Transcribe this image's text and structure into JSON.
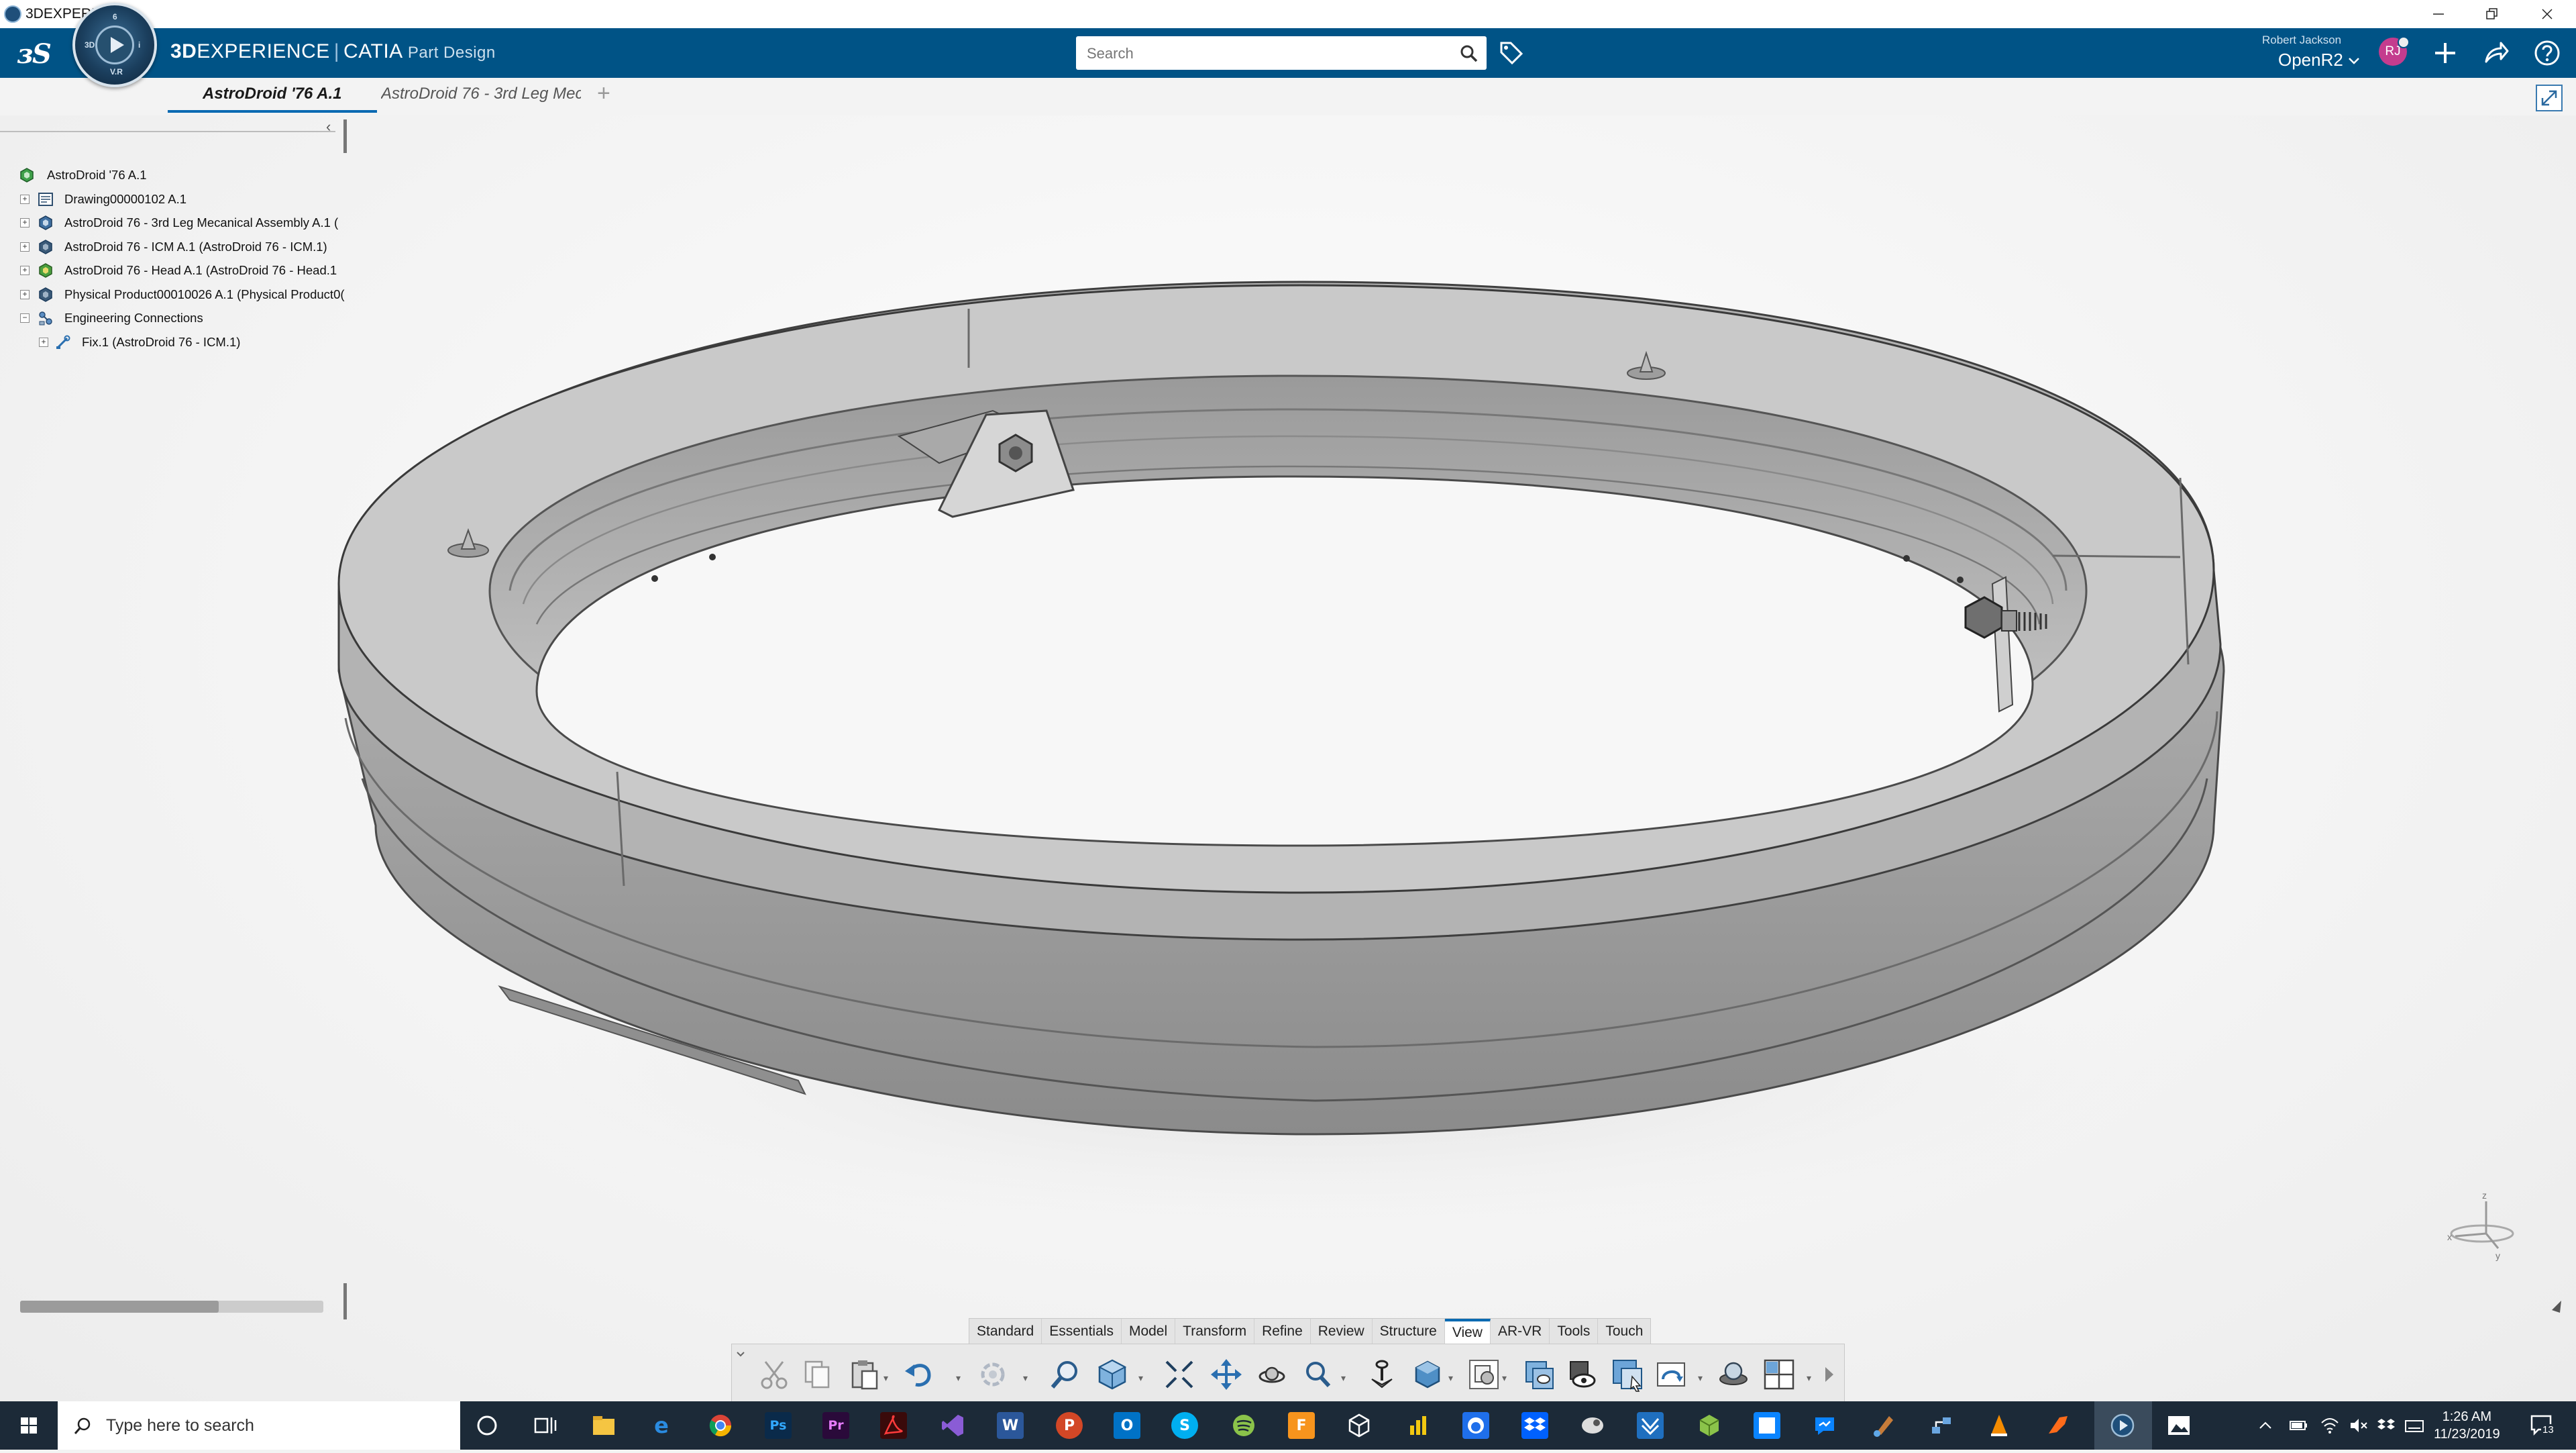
{
  "window": {
    "title": "3DEXPERIENCE",
    "controls": [
      "minimize-icon",
      "restore-icon",
      "close-icon"
    ]
  },
  "header": {
    "brand_strong": "3D",
    "brand_rest": "EXPERIENCE",
    "separator": "|",
    "app_name": "CATIA",
    "app_role": "Part Design",
    "compass_labels": [
      "3D",
      "V.R",
      "i",
      "6"
    ],
    "search_placeholder": "Search",
    "user_name": "Robert Jackson",
    "tenant": "OpenR2",
    "avatar_initials": "RJ",
    "accent_color": "#005386"
  },
  "tabs": {
    "items": [
      {
        "label": "AstroDroid '76 A.1",
        "active": true
      },
      {
        "label": "AstroDroid 76 - 3rd Leg Mec",
        "active": false
      }
    ],
    "add_label": "+"
  },
  "tree": {
    "collapse_label": "‹",
    "nodes": [
      {
        "label": "AstroDroid '76 A.1",
        "icon": "assembly-icon"
      },
      {
        "label": "Drawing00000102 A.1",
        "icon": "drawing-icon"
      },
      {
        "label": "AstroDroid 76 - 3rd Leg Mecanical Assembly A.1 (",
        "icon": "product-icon"
      },
      {
        "label": "AstroDroid 76 - ICM A.1 (AstroDroid 76 - ICM.1)",
        "icon": "product-icon"
      },
      {
        "label": "AstroDroid 76 - Head A.1 (AstroDroid 76 - Head.1",
        "icon": "product-icon"
      },
      {
        "label": "Physical Product00010026 A.1 (Physical Product0(",
        "icon": "product-icon"
      },
      {
        "label": "Engineering Connections",
        "icon": "connections-icon"
      },
      {
        "label": "Fix.1 (AstroDroid 76 - ICM.1)",
        "icon": "fix-icon"
      }
    ]
  },
  "action_bar": {
    "sections": [
      "Standard",
      "Essentials",
      "Model",
      "Transform",
      "Refine",
      "Review",
      "Structure",
      "View",
      "AR-VR",
      "Tools",
      "Touch"
    ],
    "active_section": "View",
    "tools": [
      "cut-icon",
      "copy-icon",
      "paste-icon",
      "undo-icon",
      "update-icon",
      "fit-all-icon",
      "view-cube-icon",
      "zoom-area-icon",
      "pan-icon",
      "rotate-icon",
      "zoom-icon",
      "normal-view-icon",
      "render-style-icon",
      "hide-show-icon",
      "capture-icon",
      "ambiance-icon",
      "layout-icon"
    ]
  },
  "compass_axes": [
    "x",
    "y",
    "z"
  ],
  "taskbar": {
    "search_placeholder": "Type here to search",
    "apps": [
      "cortana-icon",
      "task-view-icon",
      "file-explorer-icon",
      "edge-icon",
      "chrome-icon",
      "photoshop-icon",
      "premiere-icon",
      "acrobat-icon",
      "visual-studio-icon",
      "word-icon",
      "powerpoint-icon",
      "outlook-icon",
      "skype-icon",
      "spotify-icon",
      "fusion-icon",
      "vmware-icon",
      "powerbi-icon",
      "github-icon",
      "dropbox-icon",
      "inkscape-icon",
      "sway-icon",
      "cube-icon",
      "sticky-icon",
      "messenger-icon",
      "paint-icon",
      "network-icon",
      "vlc-icon",
      "fortify-icon",
      "3dexperience-icon",
      "photos-icon"
    ],
    "app_letters": {
      "photoshop": "Ps",
      "premiere": "Pr",
      "word": "W",
      "powerpoint": "P",
      "outlook": "O",
      "skype": "S",
      "fusion": "F"
    },
    "time": "1:26 AM",
    "date": "11/23/2019",
    "notification_count": "13"
  }
}
